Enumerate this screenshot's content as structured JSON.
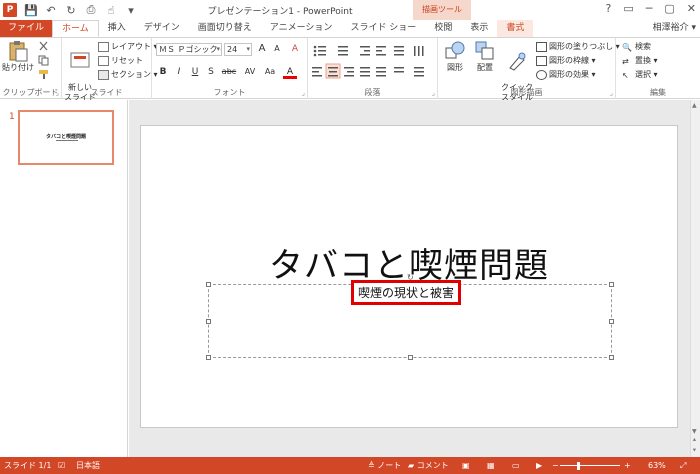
{
  "app": {
    "icon_letter": "P",
    "window_title": "プレゼンテーション1 - PowerPoint",
    "contextual_tool_title": "描画ツール",
    "user_name": "相澤裕介 ▾",
    "window_controls": [
      "?",
      "▭",
      "─",
      "▢",
      "✕"
    ]
  },
  "qat": {
    "save": "💾",
    "undo": "↶",
    "redo": "↻",
    "print": "⎙",
    "touch": "☝",
    "more": "▾"
  },
  "tabs": [
    {
      "label": "ファイル"
    },
    {
      "label": "ホーム"
    },
    {
      "label": "挿入"
    },
    {
      "label": "デザイン"
    },
    {
      "label": "画面切り替え"
    },
    {
      "label": "アニメーション"
    },
    {
      "label": "スライド ショー"
    },
    {
      "label": "校閲"
    },
    {
      "label": "表示"
    },
    {
      "label": "書式"
    }
  ],
  "ribbon": {
    "clipboard": {
      "paste": "貼り付け",
      "label": "クリップボード"
    },
    "slides": {
      "new_slide": "新しい\nスライド",
      "layout": "レイアウト ▾",
      "reset": "リセット",
      "section": "セクション ▾",
      "label": "スライド"
    },
    "font": {
      "font_name": "ＭＳ Ｐゴシック (本文)",
      "font_size": "24",
      "grow": "A",
      "shrink": "A",
      "clear": "A",
      "bold": "B",
      "italic": "I",
      "underline": "U",
      "strike": "S",
      "shadow": "abc",
      "spacing": "AV",
      "case": "Aa",
      "color": "A",
      "label": "フォント"
    },
    "paragraph": {
      "label": "段落"
    },
    "drawing": {
      "shapes": "図形",
      "arrange": "配置",
      "quick_style": "クイック\nスタイル",
      "fill": "図形の塗りつぶし ▾",
      "outline": "図形の枠線 ▾",
      "effect": "図形の効果 ▾",
      "label": "図形描画"
    },
    "editing": {
      "find": "検索",
      "replace": "置換 ▾",
      "select": "選択 ▾",
      "label": "編集"
    }
  },
  "thumbnails": [
    {
      "number": "1",
      "title": "タバコと喫煙問題"
    }
  ],
  "slide": {
    "title": "タバコと喫煙問題",
    "subtitle": "喫煙の現状と被害"
  },
  "status": {
    "slide_info": "スライド 1/1",
    "language": "日本語",
    "notes": "≜ ノート",
    "comments": "▰ コメント",
    "zoom": "63%",
    "minus": "−",
    "plus": "+"
  },
  "colors": {
    "accent": "#d24726",
    "highlight_box": "#e00000"
  }
}
